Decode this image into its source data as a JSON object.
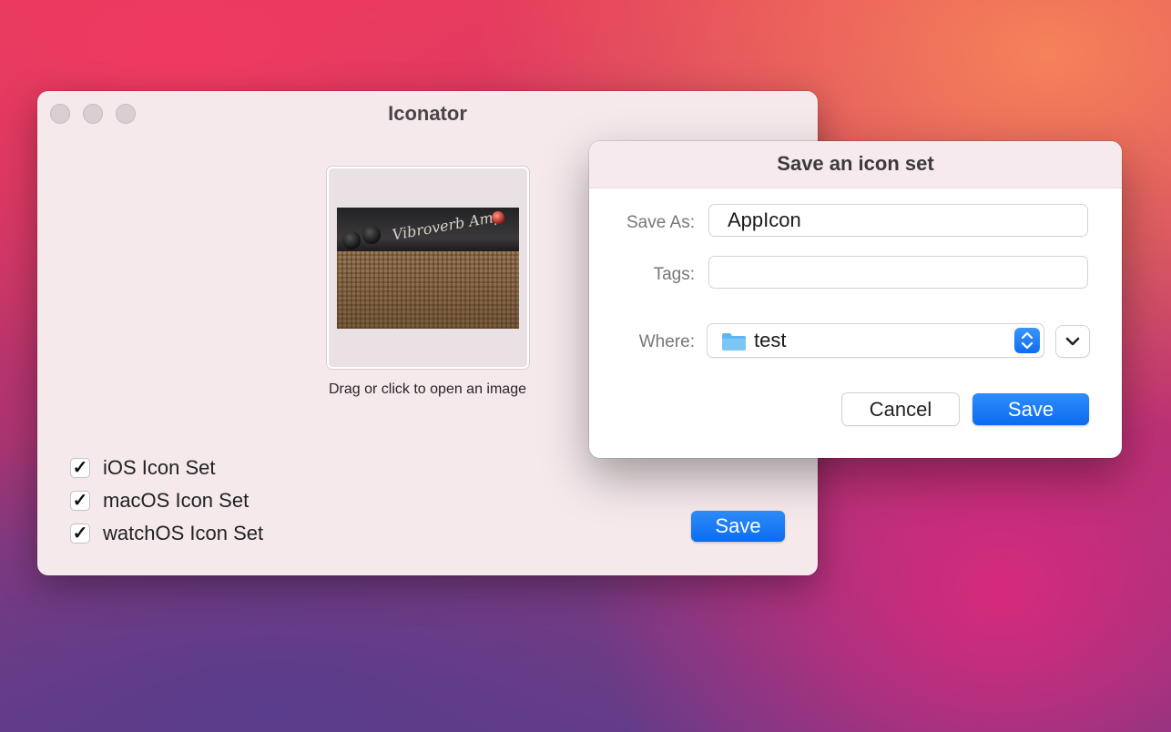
{
  "main_window": {
    "title": "Iconator",
    "drop_caption": "Drag or click to open an image",
    "image_text": "Vibroverb Amp",
    "checkboxes": [
      {
        "label": "iOS Icon Set",
        "checked": true
      },
      {
        "label": "macOS Icon Set",
        "checked": true
      },
      {
        "label": "watchOS Icon Set",
        "checked": true
      }
    ],
    "check_glyph": "✓",
    "save_label": "Save"
  },
  "sheet": {
    "title": "Save an icon set",
    "save_as_label": "Save As:",
    "save_as_value": "AppIcon",
    "tags_label": "Tags:",
    "tags_value": "",
    "where_label": "Where:",
    "where_value": "test",
    "cancel_label": "Cancel",
    "save_label": "Save"
  },
  "colors": {
    "accent": "#0a6cf0",
    "window_bg": "#f5e9ec",
    "folder": "#5fb6f2"
  },
  "icons": {
    "close": "traffic-light-close",
    "minimize": "traffic-light-minimize",
    "zoom": "traffic-light-zoom",
    "folder": "folder-icon",
    "stepper": "chevron-up-down-icon",
    "expand": "chevron-down-icon"
  }
}
